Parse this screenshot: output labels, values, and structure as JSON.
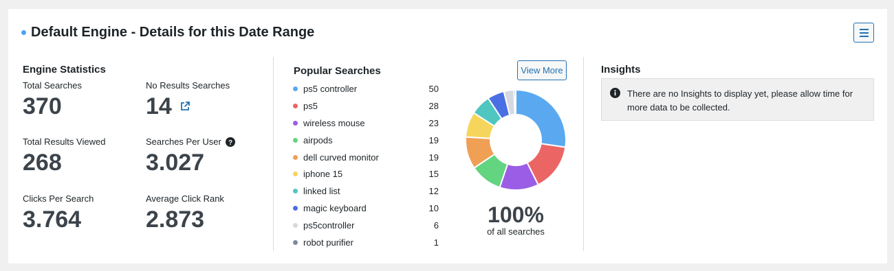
{
  "header": {
    "title": "Default Engine - Details for this Date Range",
    "menu_icon": "hamburger-menu-icon"
  },
  "engine_statistics": {
    "heading": "Engine Statistics",
    "stats": [
      {
        "label": "Total Searches",
        "value": "370"
      },
      {
        "label": "No Results Searches",
        "value": "14",
        "icon": "external-link-icon"
      },
      {
        "label": "Total Results Viewed",
        "value": "268"
      },
      {
        "label": "Searches Per User",
        "value": "3.027",
        "icon": "help-icon"
      },
      {
        "label": "Clicks Per Search",
        "value": "3.764"
      },
      {
        "label": "Average Click Rank",
        "value": "2.873"
      }
    ]
  },
  "popular_searches": {
    "heading": "Popular Searches",
    "view_more_label": "View More",
    "items": [
      {
        "term": "ps5 controller",
        "count": "50",
        "color": "#5aa9f0"
      },
      {
        "term": "ps5",
        "count": "28",
        "color": "#ec6565"
      },
      {
        "term": "wireless mouse",
        "count": "23",
        "color": "#9b5de5"
      },
      {
        "term": "airpods",
        "count": "19",
        "color": "#63d47f"
      },
      {
        "term": "dell curved monitor",
        "count": "19",
        "color": "#f0a055"
      },
      {
        "term": "iphone 15",
        "count": "15",
        "color": "#f6d55c"
      },
      {
        "term": "linked list",
        "count": "12",
        "color": "#4fc6bf"
      },
      {
        "term": "magic keyboard",
        "count": "10",
        "color": "#4a6fe3"
      },
      {
        "term": "ps5controller",
        "count": "6",
        "color": "#d6dae0"
      },
      {
        "term": "robot purifier",
        "count": "1",
        "color": "#7d8a9c"
      }
    ],
    "percent_value": "100%",
    "percent_label": "of all searches"
  },
  "chart_data": {
    "type": "pie",
    "categories": [
      "ps5 controller",
      "ps5",
      "wireless mouse",
      "airpods",
      "dell curved monitor",
      "iphone 15",
      "linked list",
      "magic keyboard",
      "ps5controller",
      "robot purifier"
    ],
    "values": [
      50,
      28,
      23,
      19,
      19,
      15,
      12,
      10,
      6,
      1
    ],
    "colors": [
      "#5aa9f0",
      "#ec6565",
      "#9b5de5",
      "#63d47f",
      "#f0a055",
      "#f6d55c",
      "#4fc6bf",
      "#4a6fe3",
      "#d6dae0",
      "#7d8a9c"
    ],
    "style": "donut"
  },
  "insights": {
    "heading": "Insights",
    "info_icon": "info-icon",
    "message": "There are no Insights to display yet, please allow time for more data to be collected."
  },
  "colors": {
    "accent": "#2271b1",
    "title_dot": "#4ba3f2",
    "stat_value": "#3c434a"
  }
}
